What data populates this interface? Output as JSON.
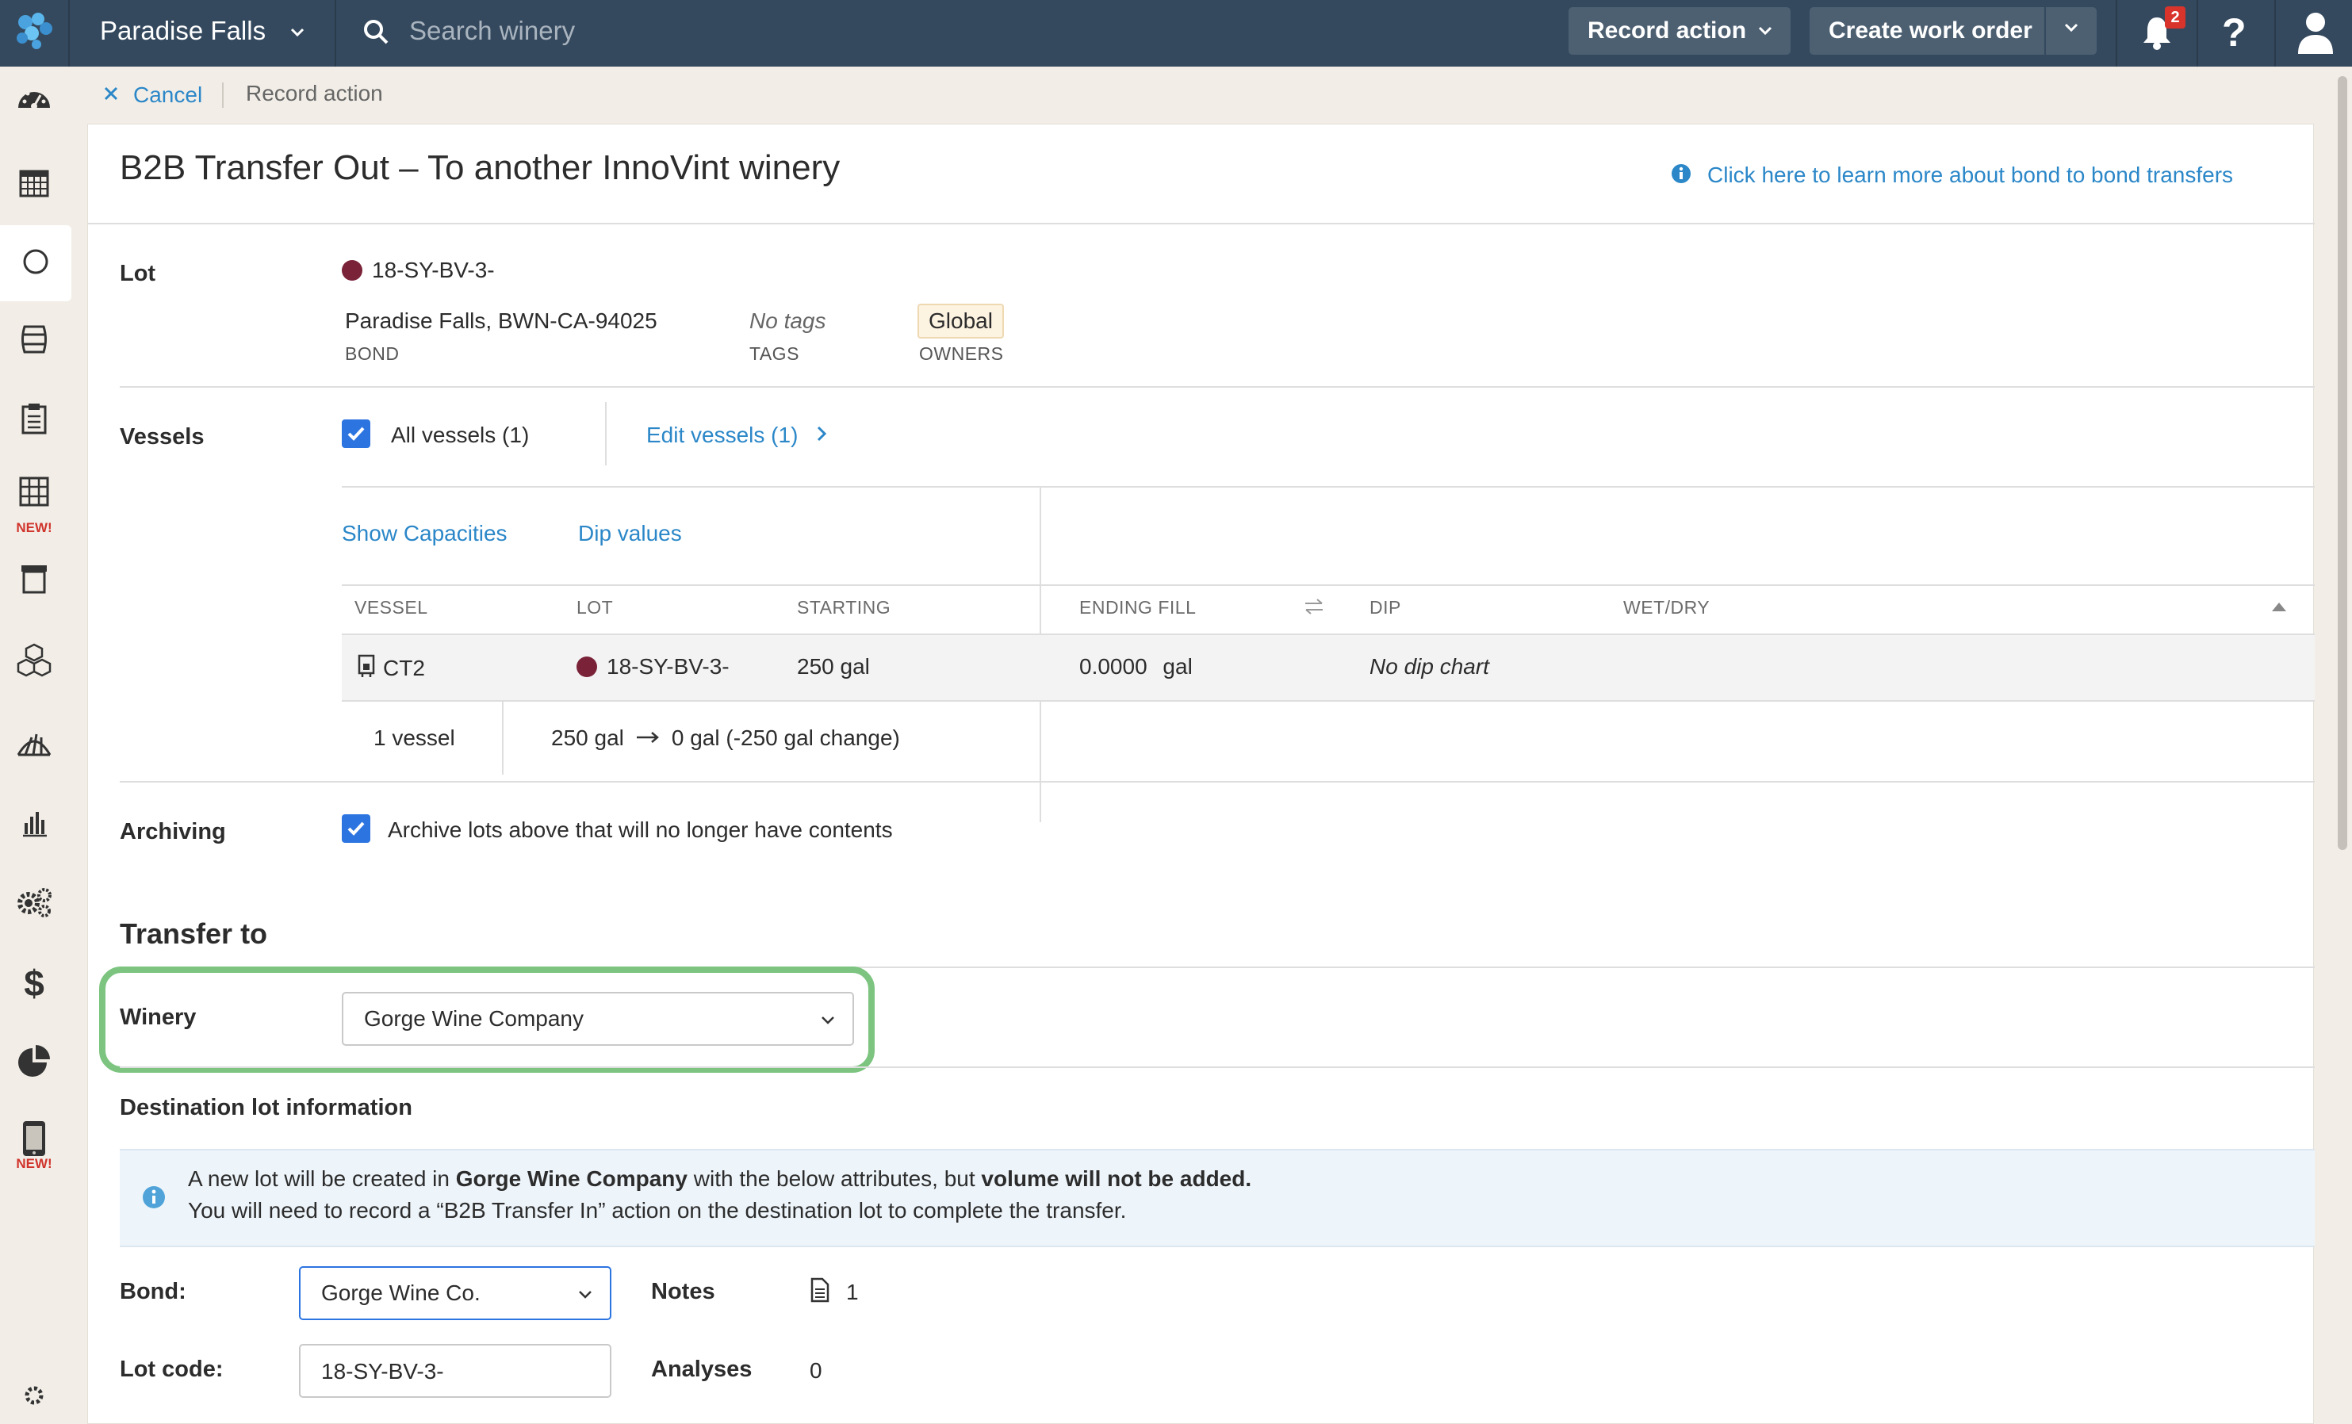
{
  "topbar": {
    "winery_name": "Paradise Falls",
    "search_placeholder": "Search winery",
    "record_action_label": "Record action",
    "create_work_order_label": "Create work order",
    "notification_count": "2"
  },
  "sidebar": {
    "new_badge": "NEW!",
    "new_badge_2": "NEW!"
  },
  "breadcrumb": {
    "cancel_label": "Cancel",
    "current": "Record action"
  },
  "page": {
    "title": "B2B Transfer Out – To another InnoVint winery",
    "help_link": "Click here to learn more about bond to bond transfers"
  },
  "lot": {
    "label": "Lot",
    "code": "18-SY-BV-3-",
    "bond_value": "Paradise Falls, BWN-CA-94025",
    "bond_caption": "BOND",
    "tags_value": "No tags",
    "tags_caption": "TAGS",
    "owner_badge": "Global",
    "owners_caption": "OWNERS",
    "dot_color": "#7a2238"
  },
  "vessels": {
    "label": "Vessels",
    "all_vessels_label": "All vessels (1)",
    "edit_vessels_label": "Edit vessels (1)",
    "show_capacities": "Show Capacities",
    "dip_values": "Dip values",
    "columns": {
      "vessel": "VESSEL",
      "lot": "LOT",
      "starting": "STARTING",
      "ending_fill": "ENDING FILL",
      "dip": "DIP",
      "wet_dry": "WET/DRY"
    },
    "rows": [
      {
        "vessel": "CT2",
        "lot": "18-SY-BV-3-",
        "starting": "250 gal",
        "ending_value": "0.0000",
        "ending_unit": "gal",
        "dip": "No dip chart",
        "wet_dry": ""
      }
    ],
    "summary_count": "1 vessel",
    "summary_from": "250 gal",
    "summary_to": "0 gal (-250 gal change)"
  },
  "archiving": {
    "label": "Archiving",
    "checkbox_label": "Archive lots above that will no longer have contents"
  },
  "transfer_to": {
    "heading": "Transfer to",
    "winery_label": "Winery",
    "winery_value": "Gorge Wine Company"
  },
  "destination": {
    "heading": "Destination lot information",
    "info_line1_pre": "A new lot will be created in ",
    "info_line1_winery": "Gorge Wine Company",
    "info_line1_mid": " with the below attributes, but ",
    "info_line1_bold": "volume will not be added.",
    "info_line2": "You will need to record a “B2B Transfer In” action on the destination lot to complete the transfer.",
    "bond_label": "Bond:",
    "bond_value": "Gorge Wine Co.",
    "notes_label": "Notes",
    "notes_count": "1",
    "lot_code_label": "Lot code:",
    "lot_code_value": "18-SY-BV-3-",
    "analyses_label": "Analyses",
    "analyses_count": "0"
  },
  "colors": {
    "topbar": "#34495e",
    "accent_link": "#2b87c8",
    "checkbox": "#2c74e0",
    "highlight_ring": "#7cc47f",
    "info_bg": "#edf4fa"
  }
}
